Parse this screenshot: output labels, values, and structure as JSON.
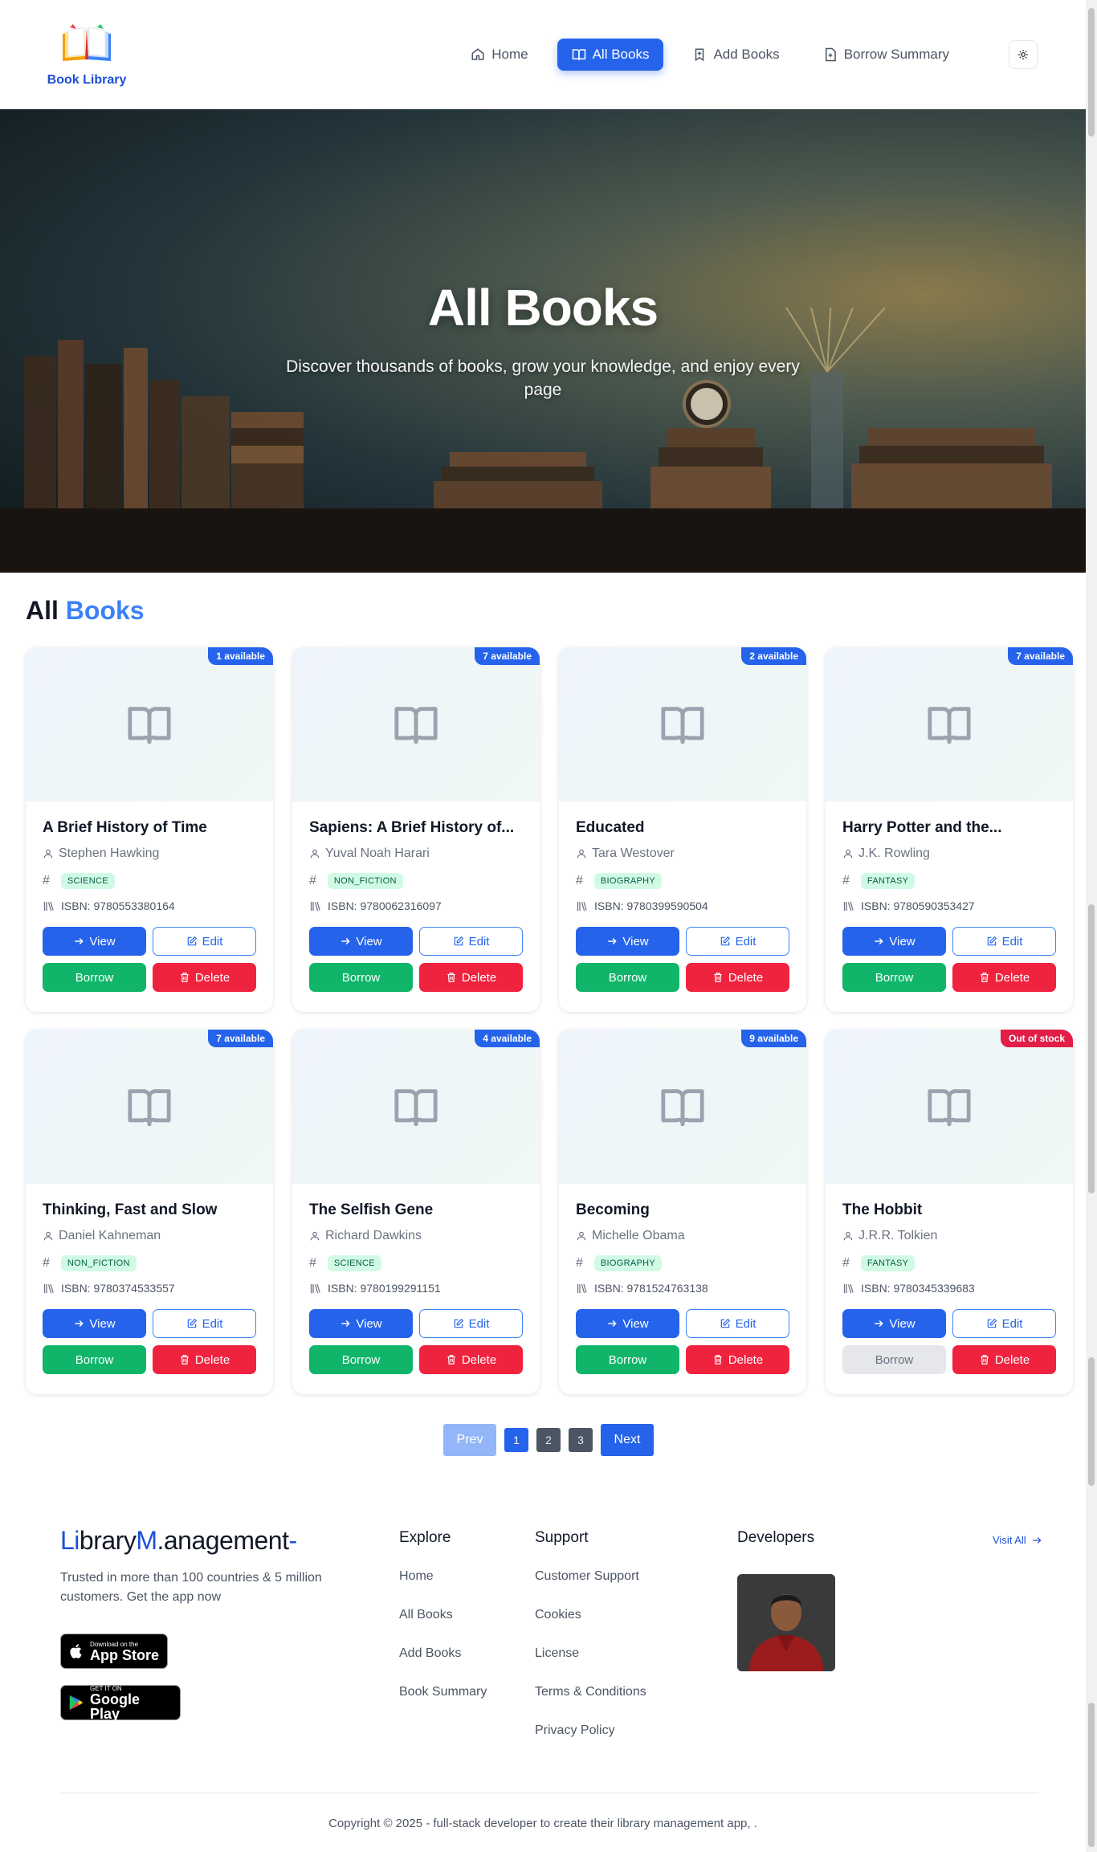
{
  "header": {
    "logo_text": "Book Library",
    "nav": [
      {
        "label": "Home",
        "icon": "home-icon",
        "active": false
      },
      {
        "label": "All Books",
        "icon": "book-open-icon",
        "active": true
      },
      {
        "label": "Add Books",
        "icon": "bookmark-plus-icon",
        "active": false
      },
      {
        "label": "Borrow Summary",
        "icon": "file-text-icon",
        "active": false
      }
    ],
    "theme_toggle_icon": "sun-icon"
  },
  "hero": {
    "title": "All Books",
    "subtitle": "Discover thousands of books, grow your knowledge, and enjoy every page"
  },
  "section": {
    "title_prefix": "All",
    "title_accent": "Books"
  },
  "books": [
    {
      "title": "A Brief History of Time",
      "author": "Stephen Hawking",
      "genre": "SCIENCE",
      "isbn": "ISBN: 9780553380164",
      "availability": "1 available",
      "in_stock": true
    },
    {
      "title": "Sapiens: A Brief History of...",
      "author": "Yuval Noah Harari",
      "genre": "NON_FICTION",
      "isbn": "ISBN: 9780062316097",
      "availability": "7 available",
      "in_stock": true
    },
    {
      "title": "Educated",
      "author": "Tara Westover",
      "genre": "BIOGRAPHY",
      "isbn": "ISBN: 9780399590504",
      "availability": "2 available",
      "in_stock": true
    },
    {
      "title": "Harry Potter and the...",
      "author": "J.K. Rowling",
      "genre": "FANTASY",
      "isbn": "ISBN: 9780590353427",
      "availability": "7 available",
      "in_stock": true
    },
    {
      "title": "Thinking, Fast and Slow",
      "author": "Daniel Kahneman",
      "genre": "NON_FICTION",
      "isbn": "ISBN: 9780374533557",
      "availability": "7 available",
      "in_stock": true
    },
    {
      "title": "The Selfish Gene",
      "author": "Richard Dawkins",
      "genre": "SCIENCE",
      "isbn": "ISBN: 9780199291151",
      "availability": "4 available",
      "in_stock": true
    },
    {
      "title": "Becoming",
      "author": "Michelle Obama",
      "genre": "BIOGRAPHY",
      "isbn": "ISBN: 9781524763138",
      "availability": "9 available",
      "in_stock": true
    },
    {
      "title": "The Hobbit",
      "author": "J.R.R. Tolkien",
      "genre": "FANTASY",
      "isbn": "ISBN: 9780345339683",
      "availability": "Out of stock",
      "in_stock": false
    }
  ],
  "card_actions": {
    "view": "View",
    "edit": "Edit",
    "borrow": "Borrow",
    "delete": "Delete"
  },
  "pagination": {
    "prev": "Prev",
    "pages": [
      "1",
      "2",
      "3"
    ],
    "current": "1",
    "next": "Next"
  },
  "footer": {
    "brand_parts": [
      "Li",
      "brary",
      "M",
      ".anagement",
      "-"
    ],
    "tagline": "Trusted in more than 100 countries & 5 million customers. Get the app now",
    "app_store": {
      "small": "Download on the",
      "big": "App Store"
    },
    "google_play": {
      "small": "GET IT ON",
      "big": "Google Play"
    },
    "explore": {
      "title": "Explore",
      "links": [
        "Home",
        "All Books",
        "Add Books",
        "Book Summary"
      ]
    },
    "support": {
      "title": "Support",
      "links": [
        "Customer Support",
        "Cookies",
        "License",
        "Terms & Conditions",
        "Privacy Policy"
      ]
    },
    "developers": {
      "title": "Developers",
      "visit_all": "Visit All"
    },
    "copyright": "Copyright © 2025 - full-stack developer to create their library management app, ."
  },
  "colors": {
    "primary": "#2563eb",
    "success": "#10b56a",
    "danger": "#f0233f",
    "genre_bg": "#d1fae5",
    "out_of_stock": "#e11d48"
  }
}
